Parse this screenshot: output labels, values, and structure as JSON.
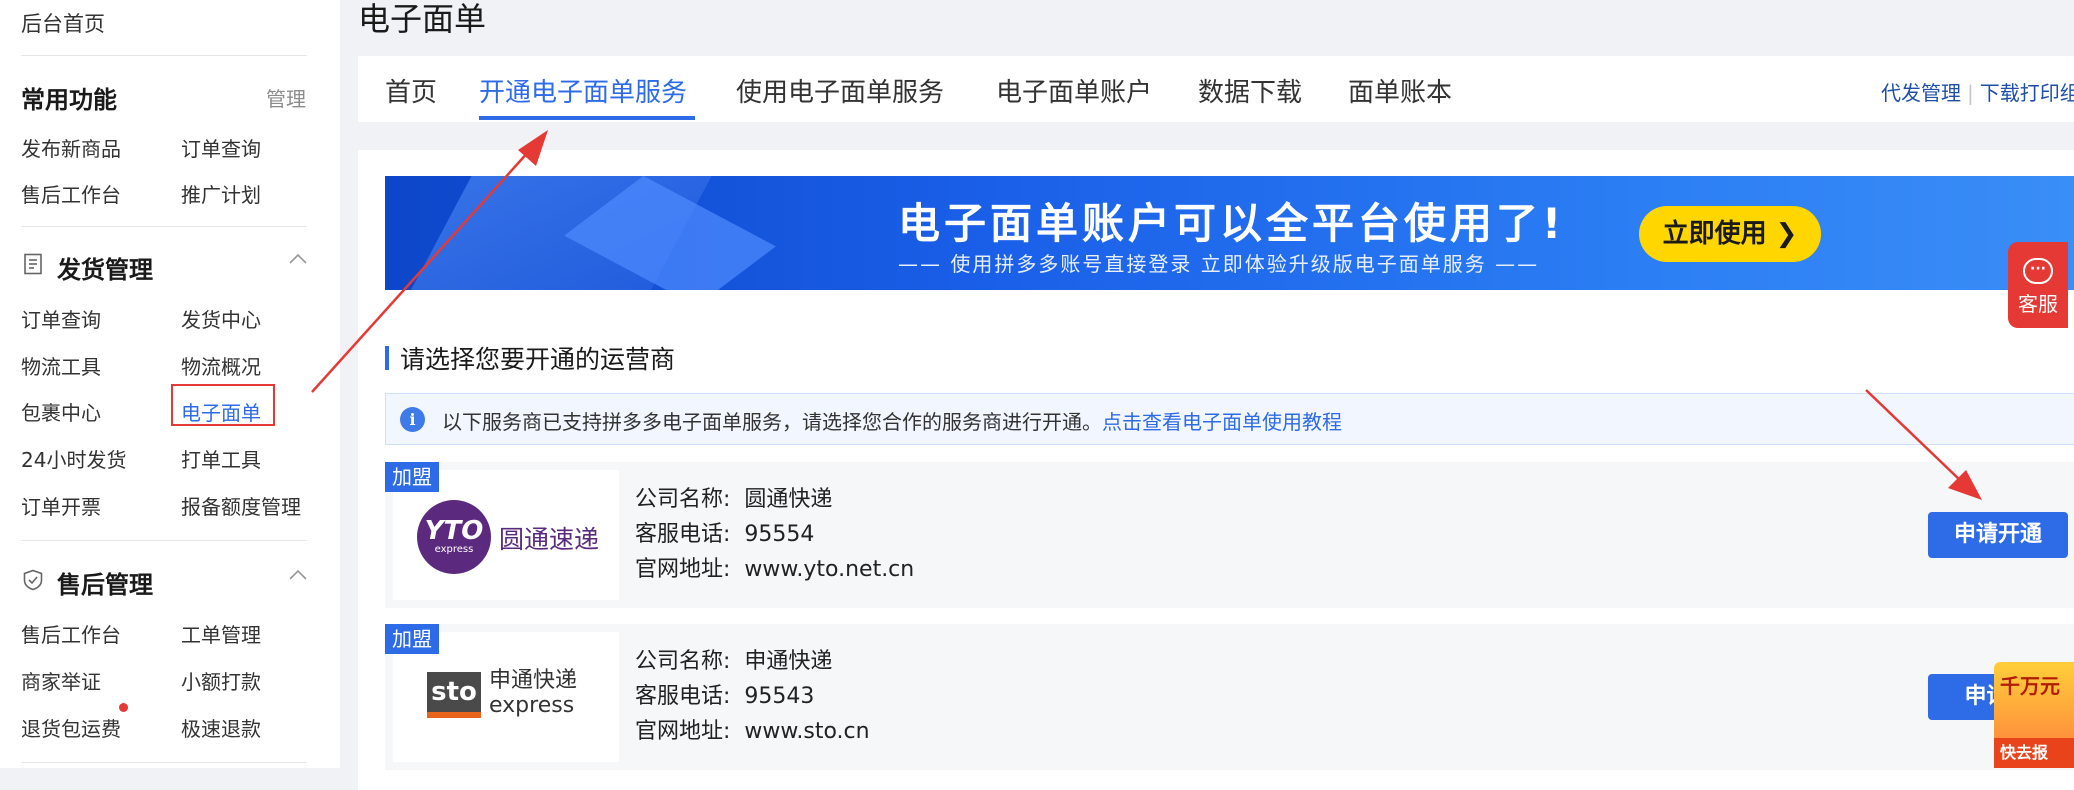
{
  "sidebar": {
    "home": "后台首页",
    "common": {
      "title": "常用功能",
      "manage": "管理",
      "items": [
        "发布新商品",
        "订单查询",
        "售后工作台",
        "推广计划"
      ]
    },
    "shipping": {
      "title": "发货管理",
      "icon": "document-icon",
      "items": [
        "订单查询",
        "发货中心",
        "物流工具",
        "物流概况",
        "包裹中心",
        "电子面单",
        "24小时发货",
        "打单工具",
        "订单开票",
        "报备额度管理"
      ],
      "active": "电子面单"
    },
    "aftersale": {
      "title": "售后管理",
      "icon": "shield-icon",
      "items": [
        "售后工作台",
        "工单管理",
        "商家举证",
        "小额打款",
        "退货包运费",
        "极速退款"
      ]
    }
  },
  "page": {
    "title": "电子面单"
  },
  "tabs": {
    "items": [
      "首页",
      "开通电子面单服务",
      "使用电子面单服务",
      "电子面单账户",
      "数据下载",
      "面单账本"
    ],
    "active": "开通电子面单服务",
    "links": [
      "代发管理",
      "下载打印组"
    ]
  },
  "banner": {
    "title": "电子面单账户可以全平台使用了!",
    "subtitle": "—— 使用拼多多账号直接登录  立即体验升级版电子面单服务 ——",
    "button": "立即使用 ❯"
  },
  "customer_service": {
    "label": "客服"
  },
  "section": {
    "title": "请选择您要开通的运营商",
    "info": "以下服务商已支持拼多多电子面单服务，请选择您合作的服务商进行开通。",
    "info_link": "点击查看电子面单使用教程"
  },
  "carriers": [
    {
      "badge": "加盟",
      "logo_mark": "YTO",
      "logo_sub": "express",
      "logo_name": "圆通速递",
      "company_label": "公司名称:",
      "company": "圆通快递",
      "phone_label": "客服电话:",
      "phone": "95554",
      "site_label": "官网地址:",
      "site": "www.yto.net.cn",
      "button": "申请开通"
    },
    {
      "badge": "加盟",
      "logo_mark": "sto",
      "logo_name": "申通快递",
      "logo_sub": "express",
      "company_label": "公司名称:",
      "company": "申通快递",
      "phone_label": "客服电话:",
      "phone": "95543",
      "site_label": "官网地址:",
      "site": "www.sto.cn",
      "button": "申请"
    }
  ],
  "promo": {
    "top": "千万元",
    "bottom": "快去报"
  },
  "colors": {
    "accent": "#2e6be6",
    "highlight": "#e53935",
    "banner_button": "#ffd600"
  }
}
